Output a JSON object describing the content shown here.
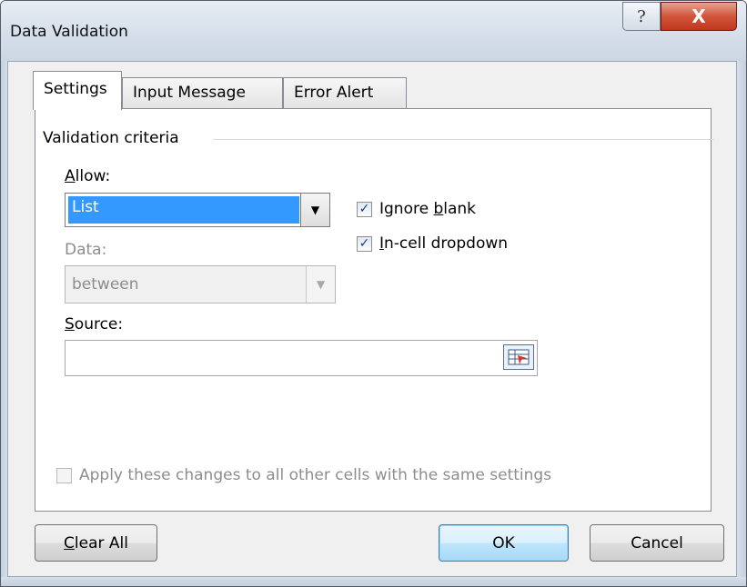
{
  "window": {
    "title": "Data Validation",
    "help_symbol": "?",
    "close_symbol": "X"
  },
  "tabs": [
    {
      "label": "Settings",
      "active": true
    },
    {
      "label": "Input Message",
      "active": false
    },
    {
      "label": "Error Alert",
      "active": false
    }
  ],
  "settings": {
    "group_label": "Validation criteria",
    "allow": {
      "label_accel": "A",
      "label_rest": "llow:",
      "value": "List"
    },
    "data": {
      "label": "Data:",
      "value": "between",
      "enabled": false
    },
    "ignore_blank": {
      "label_pre": "Ignore ",
      "label_accel": "b",
      "label_post": "lank",
      "checked": true
    },
    "incell_dropdown": {
      "label_accel": "I",
      "label_rest": "n-cell dropdown",
      "checked": true
    },
    "source": {
      "label_accel": "S",
      "label_rest": "ource:",
      "value": ""
    },
    "apply_all": {
      "label": "Apply these changes to all other cells with the same settings",
      "checked": false,
      "enabled": false
    }
  },
  "buttons": {
    "clear_all_accel": "C",
    "clear_all_rest": "lear All",
    "ok": "OK",
    "cancel": "Cancel"
  },
  "colors": {
    "selection": "#3399ff",
    "close_button": "#c0381d",
    "titlebar": "#d6dfea"
  }
}
